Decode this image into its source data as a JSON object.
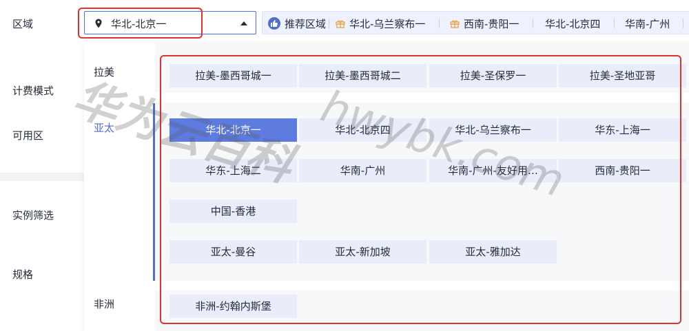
{
  "labels": {
    "region": "区域",
    "billing": "计费模式",
    "zone": "可用区",
    "filter": "实例筛选",
    "spec": "规格"
  },
  "region_select": {
    "value": "华北-北京一",
    "icon": "location-pin-icon"
  },
  "recommended": {
    "title": "推荐区域",
    "items": [
      "华北-乌兰察布一",
      "西南-贵阳一",
      "华北-北京四",
      "华南-广州"
    ]
  },
  "categories": [
    "拉美",
    "亚太",
    "非洲"
  ],
  "regions": {
    "latam": [
      "拉美-墨西哥城一",
      "拉美-墨西哥城二",
      "拉美-圣保罗一",
      "拉美-圣地亚哥"
    ],
    "apac_row1": [
      "华北-北京一",
      "华北-北京四",
      "华北-乌兰察布一",
      "华东-上海一"
    ],
    "apac_row2": [
      "华东-上海二",
      "华南-广州",
      "华南-广州-友好用…",
      "西南-贵阳一"
    ],
    "apac_row3": [
      "中国-香港"
    ],
    "apac_row4": [
      "亚太-曼谷",
      "亚太-新加坡",
      "亚太-雅加达"
    ],
    "africa": [
      "非洲-约翰内斯堡"
    ]
  },
  "selected_region": "华北-北京一",
  "watermark": {
    "cn": "华为云百科",
    "en": "hwybk.com"
  },
  "colors": {
    "accent": "#5e7ce0",
    "highlight": "#e03131"
  }
}
